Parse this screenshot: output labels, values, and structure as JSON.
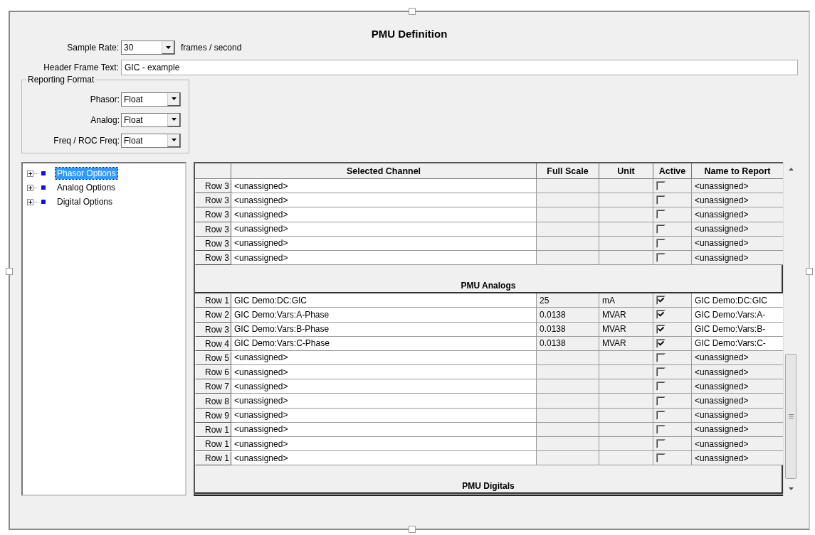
{
  "title": "PMU Definition",
  "sample_rate": {
    "label": "Sample Rate:",
    "value": "30",
    "suffix": "frames / second"
  },
  "header_frame_text": {
    "label": "Header Frame Text:",
    "value": "GIC - example"
  },
  "reporting_format": {
    "legend": "Reporting Format",
    "fields": [
      {
        "label": "Phasor:",
        "value": "Float"
      },
      {
        "label": "Analog:",
        "value": "Float"
      },
      {
        "label": "Freq / ROC Freq:",
        "value": "Float"
      }
    ]
  },
  "tree": [
    {
      "label": "Phasor Options",
      "selected": true,
      "expanded": false
    },
    {
      "label": "Analog Options",
      "selected": false,
      "expanded": false
    },
    {
      "label": "Digital Options",
      "selected": false,
      "expanded": false
    }
  ],
  "table": {
    "columns": [
      "Selected Channel",
      "Full Scale",
      "Unit",
      "Active",
      "Name to Report"
    ],
    "sections": [
      {
        "rows": [
          {
            "row": "Row 3",
            "channel": "<unassigned>",
            "active": false,
            "name": "<unassigned>"
          },
          {
            "row": "Row 3",
            "channel": "<unassigned>",
            "active": false,
            "name": "<unassigned>"
          },
          {
            "row": "Row 3",
            "channel": "<unassigned>",
            "active": false,
            "name": "<unassigned>"
          },
          {
            "row": "Row 3",
            "channel": "<unassigned>",
            "active": false,
            "name": "<unassigned>"
          },
          {
            "row": "Row 3",
            "channel": "<unassigned>",
            "active": false,
            "name": "<unassigned>"
          },
          {
            "row": "Row 3",
            "channel": "<unassigned>",
            "active": false,
            "name": "<unassigned>"
          }
        ]
      },
      {
        "title": "PMU Analogs",
        "rows": [
          {
            "row": "Row 1",
            "channel": "GIC Demo:DC:GIC",
            "full_scale": "25",
            "unit": "mA",
            "active": true,
            "name": "GIC Demo:DC:GIC"
          },
          {
            "row": "Row 2",
            "channel": "GIC Demo:Vars:A-Phase",
            "full_scale": "0.0138",
            "unit": "MVAR",
            "active": true,
            "name": "GIC Demo:Vars:A-"
          },
          {
            "row": "Row 3",
            "channel": "GIC Demo:Vars:B-Phase",
            "full_scale": "0.0138",
            "unit": "MVAR",
            "active": true,
            "name": "GIC Demo:Vars:B-"
          },
          {
            "row": "Row 4",
            "channel": "GIC Demo:Vars:C-Phase",
            "full_scale": "0.0138",
            "unit": "MVAR",
            "active": true,
            "name": "GIC Demo:Vars:C-"
          },
          {
            "row": "Row 5",
            "channel": "<unassigned>",
            "active": false,
            "name": "<unassigned>"
          },
          {
            "row": "Row 6",
            "channel": "<unassigned>",
            "active": false,
            "name": "<unassigned>"
          },
          {
            "row": "Row 7",
            "channel": "<unassigned>",
            "active": false,
            "name": "<unassigned>"
          },
          {
            "row": "Row 8",
            "channel": "<unassigned>",
            "active": false,
            "name": "<unassigned>"
          },
          {
            "row": "Row 9",
            "channel": "<unassigned>",
            "active": false,
            "name": "<unassigned>"
          },
          {
            "row": "Row 1",
            "channel": "<unassigned>",
            "active": false,
            "name": "<unassigned>"
          },
          {
            "row": "Row 1",
            "channel": "<unassigned>",
            "active": false,
            "name": "<unassigned>"
          },
          {
            "row": "Row 1",
            "channel": "<unassigned>",
            "active": false,
            "name": "<unassigned>"
          }
        ]
      },
      {
        "title": "PMU Digitals"
      }
    ]
  }
}
